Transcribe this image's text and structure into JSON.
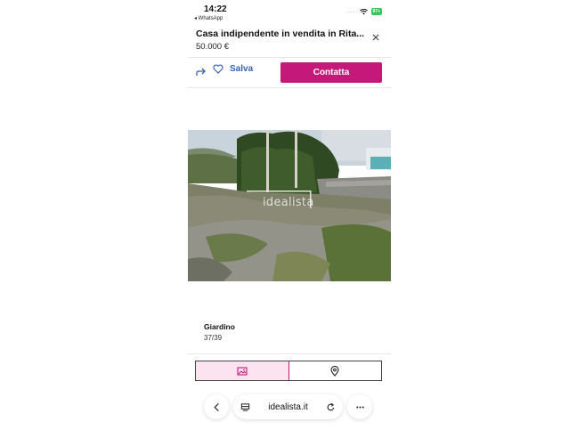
{
  "status_bar": {
    "time": "14:22",
    "back_app": "◂ WhatsApp",
    "signal": "....",
    "battery": "97+"
  },
  "listing": {
    "title": "Casa indipendente in vendita in Rita...",
    "price": "50.000 €"
  },
  "actions": {
    "save_label": "Salva",
    "contact_label": "Contatta"
  },
  "photo": {
    "watermark": "idealista",
    "caption": "Giardino",
    "counter": "37/39"
  },
  "browser": {
    "url": "idealista.it"
  },
  "colors": {
    "brand": "#c4197a",
    "save_link": "#3a5fb8",
    "battery": "#34c759"
  },
  "icons": [
    "share-icon",
    "heart-icon",
    "close-icon",
    "image-icon",
    "map-pin-icon",
    "back-icon",
    "tab-overview-icon",
    "reload-icon",
    "more-icon",
    "wifi-icon"
  ]
}
